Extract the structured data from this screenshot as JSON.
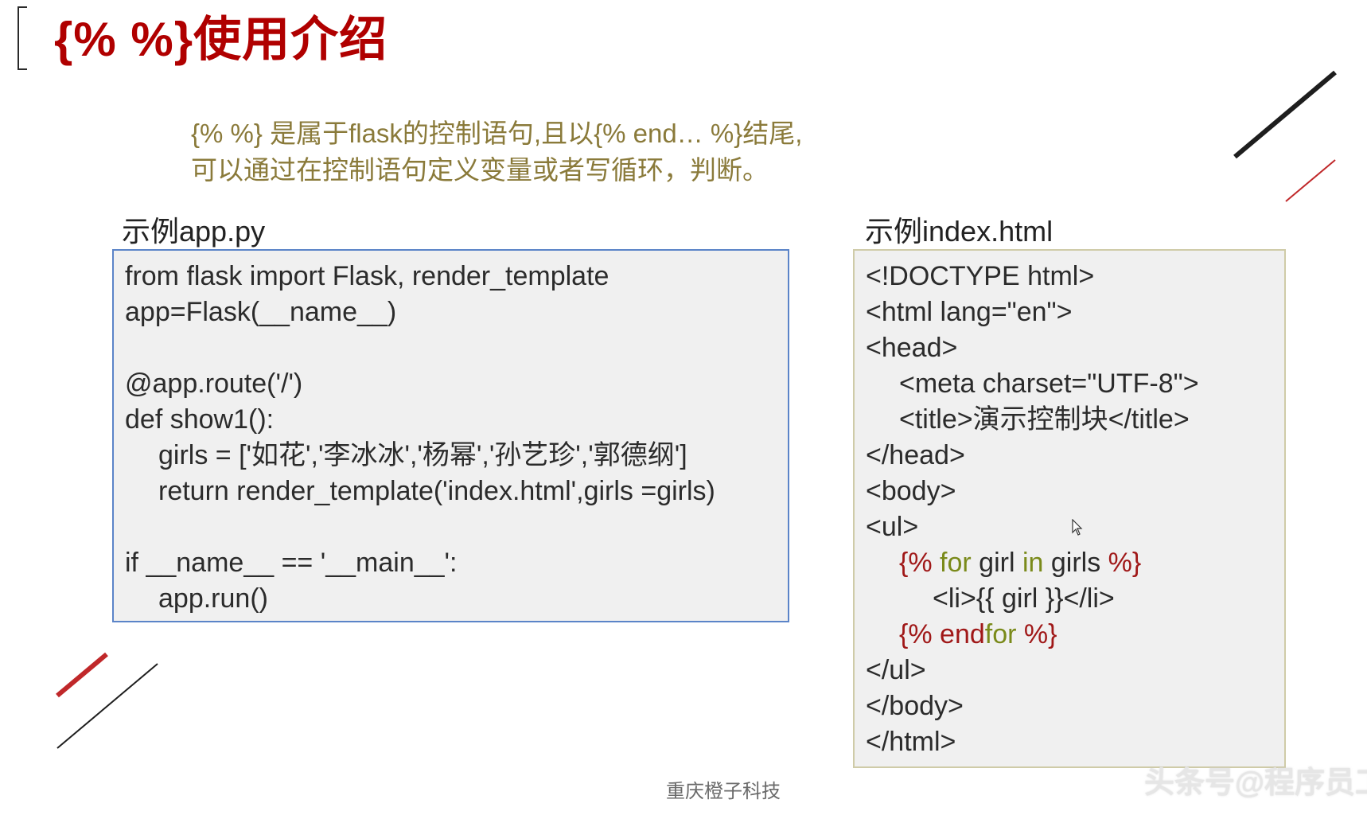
{
  "title": "{% %}使用介绍",
  "intro": {
    "line1": "{% %} 是属于flask的控制语句,且以{% end… %}结尾,",
    "line2": "可以通过在控制语句定义变量或者写循环，判断。"
  },
  "app_label": "示例app.py",
  "index_label": "示例index.html",
  "app_code": {
    "l1": "from flask import Flask, render_template",
    "l2": "app=Flask(__name__)",
    "l3": "",
    "l4": "@app.route('/')",
    "l5": "def show1():",
    "l6": "girls = ['如花','李冰冰','杨幂','孙艺珍','郭德纲']",
    "l7": "return render_template('index.html',girls =girls)",
    "l8": "",
    "l9": "if __name__ == '__main__':",
    "l10": "app.run()"
  },
  "index_code": {
    "l1": "<!DOCTYPE html>",
    "l2": "<html lang=\"en\">",
    "l3": "<head>",
    "l4": "<meta charset=\"UTF-8\">",
    "l5": "<title>演示控制块</title>",
    "l6": "</head>",
    "l7": "<body>",
    "l8": "<ul>",
    "l9": {
      "open": "{% ",
      "for": "for",
      "girl": " girl ",
      "in": "in",
      "girls": " girls ",
      "close": "%}"
    },
    "l10": "<li>{{ girl }}</li>",
    "l11": {
      "open": "{% end",
      "for": "for",
      "close": " %}"
    },
    "l12": "</ul>",
    "l13": "</body>",
    "l14": "</html>"
  },
  "footer": "重庆橙子科技",
  "watermark": "头条号@程序员工作室",
  "colors": {
    "title": "#b00000",
    "intro": "#8a7a3a",
    "left_border": "#5b84c8",
    "right_border": "#cfcba8",
    "keyword_red": "#a01818",
    "keyword_olive": "#7a8a1a"
  }
}
